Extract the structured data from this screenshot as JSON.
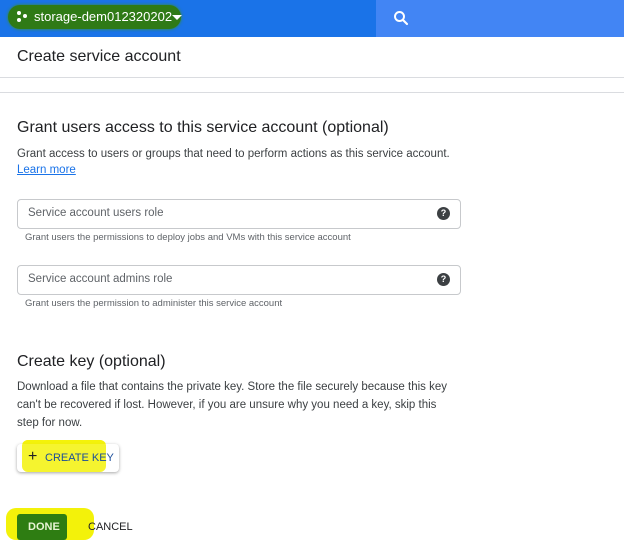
{
  "topbar": {
    "project_name": "storage-dem012320202",
    "colors": {
      "bar": "#1a73e8",
      "search": "#4285f4",
      "highlight": "#f3f20a"
    },
    "search_icon": "search-icon",
    "project_icon": "project-dots-icon",
    "dropdown_icon": "chevron-down-icon"
  },
  "page": {
    "title": "Create service account"
  },
  "grant": {
    "title": "Grant users access to this service account (optional)",
    "description": "Grant access to users or groups that need to perform actions as this service account.",
    "learn_more": "Learn more",
    "users_role": {
      "placeholder": "Service account users role",
      "hint": "Grant users the permissions to deploy jobs and VMs with this service account"
    },
    "admins_role": {
      "placeholder": "Service account admins role",
      "hint": "Grant users the permission to administer this service account"
    },
    "help_icon": "?"
  },
  "create_key": {
    "title": "Create key (optional)",
    "description": "Download a file that contains the private key. Store the file securely because this key can't be recovered if lost. However, if you are unsure why you need a key, skip this step for now.",
    "button_plus": "+",
    "button_label": "CREATE KEY"
  },
  "actions": {
    "done": "DONE",
    "cancel": "CANCEL"
  }
}
